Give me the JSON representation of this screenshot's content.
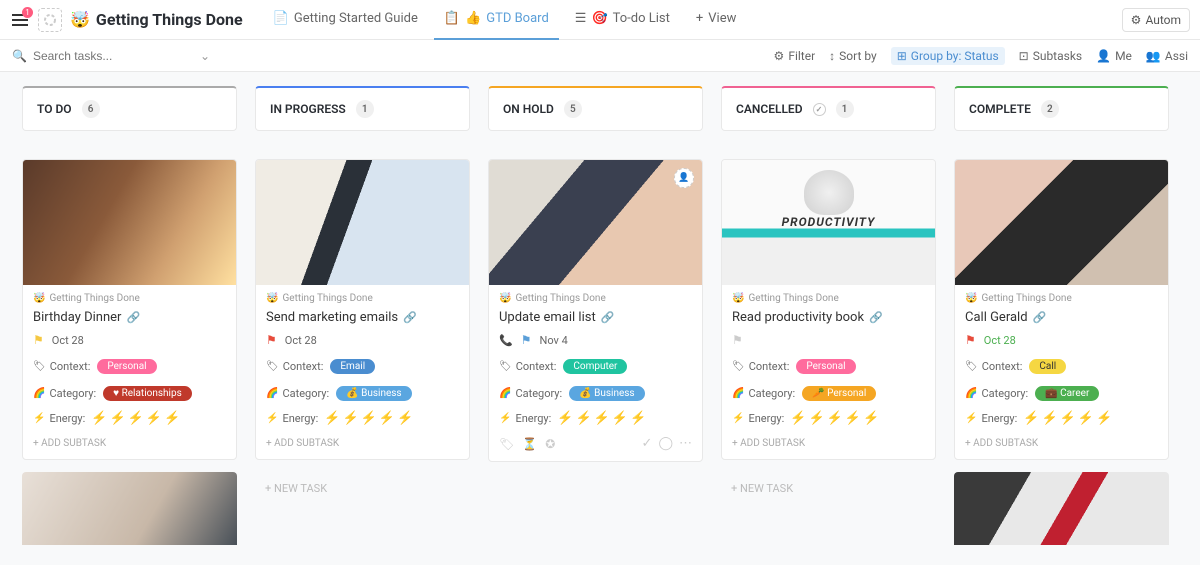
{
  "header": {
    "notif_badge": "1",
    "emoji": "🤯",
    "title": "Getting Things Done",
    "views": [
      {
        "icon": "📄",
        "label": "Getting Started Guide",
        "active": false
      },
      {
        "icon": "📋",
        "label": "GTD Board",
        "active": true,
        "thumb": "👍"
      },
      {
        "icon": "☰",
        "label": "To-do List",
        "active": false,
        "thumb": "🎯"
      },
      {
        "icon": "+",
        "label": "View",
        "active": false
      }
    ],
    "autom_btn": "Autom"
  },
  "filterbar": {
    "search_placeholder": "Search tasks...",
    "items": [
      {
        "icon": "⚙",
        "label": "Filter"
      },
      {
        "icon": "↕",
        "label": "Sort by"
      },
      {
        "icon": "⊞",
        "label": "Group by: Status",
        "active": true
      },
      {
        "icon": "⊡",
        "label": "Subtasks"
      },
      {
        "icon": "👤",
        "label": "Me"
      },
      {
        "icon": "👥",
        "label": "Assi"
      }
    ]
  },
  "columns": [
    {
      "key": "todo",
      "label": "TO DO",
      "count": "6"
    },
    {
      "key": "inprogress",
      "label": "IN PROGRESS",
      "count": "1"
    },
    {
      "key": "onhold",
      "label": "ON HOLD",
      "count": "5"
    },
    {
      "key": "cancelled",
      "label": "CANCELLED",
      "count": "1",
      "check": true
    },
    {
      "key": "complete",
      "label": "COMPLETE",
      "count": "2"
    }
  ],
  "labels": {
    "crumb": "Getting Things Done",
    "context": "Context:",
    "category": "Category:",
    "energy": "Energy:",
    "add_subtask": "+ ADD SUBTASK",
    "new_task": "+ NEW TASK"
  },
  "cards": {
    "todo": {
      "title": "Birthday Dinner",
      "flag": "yellow",
      "date": "Oct 28",
      "context": {
        "label": "Personal",
        "cls": "pink"
      },
      "category": {
        "label": "Relationships",
        "cls": "darkred",
        "emoji": "♥"
      },
      "energy": 5
    },
    "inprogress": {
      "title": "Send marketing emails",
      "flag": "red",
      "date": "Oct 28",
      "context": {
        "label": "Email",
        "cls": "blue"
      },
      "category": {
        "label": "Business",
        "cls": "skyblue",
        "emoji": "💰"
      },
      "energy": 3
    },
    "onhold": {
      "title": "Update email list",
      "flag": "blue",
      "date": "Nov 4",
      "context": {
        "label": "Computer",
        "cls": "teal"
      },
      "category": {
        "label": "Business",
        "cls": "skyblue",
        "emoji": "💰"
      },
      "energy": 3,
      "show_actions": true
    },
    "cancelled": {
      "title": "Read productivity book",
      "flag": "outline",
      "date": "",
      "context": {
        "label": "Personal",
        "cls": "pink"
      },
      "category": {
        "label": "Personal",
        "cls": "orange",
        "emoji": "🥕"
      },
      "energy": 2
    },
    "complete": {
      "title": "Call Gerald",
      "flag": "red",
      "date": "Oct 28",
      "date_cls": "green",
      "context": {
        "label": "Call",
        "cls": "yellow"
      },
      "category": {
        "label": "Career",
        "cls": "green",
        "emoji": "💼"
      },
      "energy": 4
    }
  }
}
